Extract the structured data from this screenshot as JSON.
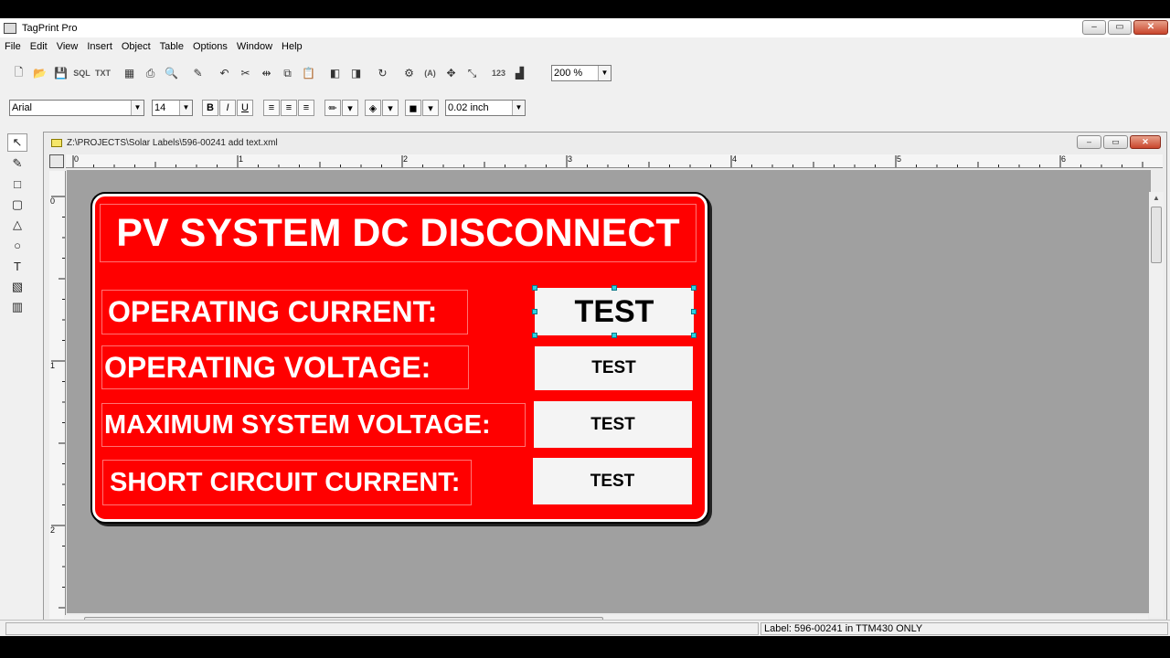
{
  "window": {
    "title": "TagPrint Pro",
    "min": "–",
    "max": "▭",
    "close": "✕"
  },
  "menu": [
    "File",
    "Edit",
    "View",
    "Insert",
    "Object",
    "Table",
    "Options",
    "Window",
    "Help"
  ],
  "toolbar": {
    "sql_label": "SQL",
    "txt_label": "TXT",
    "num_label": "123",
    "zoom_value": "200 %",
    "font_name": "Arial",
    "font_size": "14",
    "bold": "B",
    "italic": "I",
    "underline": "U",
    "line_width": "0.02 inch",
    "text_tool": "(A)"
  },
  "palette": {
    "text_tool": "T"
  },
  "document": {
    "title": "Z:\\PROJECTS\\Solar Labels\\596-00241 add text.xml",
    "ruler_h": [
      "0",
      "1",
      "2",
      "3",
      "4",
      "5",
      "6"
    ],
    "ruler_v": [
      "0",
      "1",
      "2"
    ]
  },
  "label": {
    "heading": "PV SYSTEM DC DISCONNECT",
    "rows": [
      {
        "caption": "OPERATING CURRENT:",
        "value": "TEST"
      },
      {
        "caption": "OPERATING VOLTAGE:",
        "value": "TEST"
      },
      {
        "caption": "MAXIMUM SYSTEM VOLTAGE:",
        "value": "TEST"
      },
      {
        "caption": "SHORT CIRCUIT CURRENT:",
        "value": "TEST"
      }
    ],
    "colors": {
      "background": "#ff0000",
      "text": "#ffffff",
      "field": "#f4f4f4"
    }
  },
  "status": {
    "label_info": "Label: 596-00241 in TTM430 ONLY"
  }
}
